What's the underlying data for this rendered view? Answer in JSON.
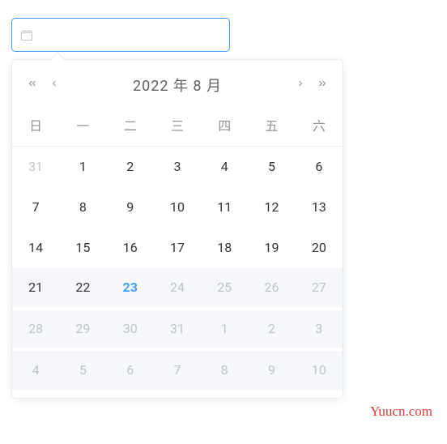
{
  "input": {
    "value": "",
    "placeholder": ""
  },
  "header": {
    "title": "2022 年  8 月"
  },
  "weekdays": [
    "日",
    "一",
    "二",
    "三",
    "四",
    "五",
    "六"
  ],
  "weeks": [
    {
      "disabled": false,
      "days": [
        {
          "n": "31",
          "cls": "prev"
        },
        {
          "n": "1",
          "cls": ""
        },
        {
          "n": "2",
          "cls": ""
        },
        {
          "n": "3",
          "cls": ""
        },
        {
          "n": "4",
          "cls": ""
        },
        {
          "n": "5",
          "cls": ""
        },
        {
          "n": "6",
          "cls": ""
        }
      ]
    },
    {
      "disabled": false,
      "days": [
        {
          "n": "7",
          "cls": ""
        },
        {
          "n": "8",
          "cls": ""
        },
        {
          "n": "9",
          "cls": ""
        },
        {
          "n": "10",
          "cls": ""
        },
        {
          "n": "11",
          "cls": ""
        },
        {
          "n": "12",
          "cls": ""
        },
        {
          "n": "13",
          "cls": ""
        }
      ]
    },
    {
      "disabled": false,
      "days": [
        {
          "n": "14",
          "cls": ""
        },
        {
          "n": "15",
          "cls": ""
        },
        {
          "n": "16",
          "cls": ""
        },
        {
          "n": "17",
          "cls": ""
        },
        {
          "n": "18",
          "cls": ""
        },
        {
          "n": "19",
          "cls": ""
        },
        {
          "n": "20",
          "cls": ""
        }
      ]
    },
    {
      "disabled": true,
      "days": [
        {
          "n": "21",
          "cls": "keep"
        },
        {
          "n": "22",
          "cls": "keep"
        },
        {
          "n": "23",
          "cls": "today"
        },
        {
          "n": "24",
          "cls": ""
        },
        {
          "n": "25",
          "cls": ""
        },
        {
          "n": "26",
          "cls": ""
        },
        {
          "n": "27",
          "cls": ""
        }
      ]
    },
    {
      "disabled": true,
      "days": [
        {
          "n": "28",
          "cls": ""
        },
        {
          "n": "29",
          "cls": ""
        },
        {
          "n": "30",
          "cls": ""
        },
        {
          "n": "31",
          "cls": ""
        },
        {
          "n": "1",
          "cls": "next"
        },
        {
          "n": "2",
          "cls": "next"
        },
        {
          "n": "3",
          "cls": "next"
        }
      ]
    },
    {
      "disabled": true,
      "days": [
        {
          "n": "4",
          "cls": "next"
        },
        {
          "n": "5",
          "cls": "next"
        },
        {
          "n": "6",
          "cls": "next"
        },
        {
          "n": "7",
          "cls": "next"
        },
        {
          "n": "8",
          "cls": "next"
        },
        {
          "n": "9",
          "cls": "next"
        },
        {
          "n": "10",
          "cls": "next"
        }
      ]
    }
  ],
  "watermark": "Yuucn.com"
}
